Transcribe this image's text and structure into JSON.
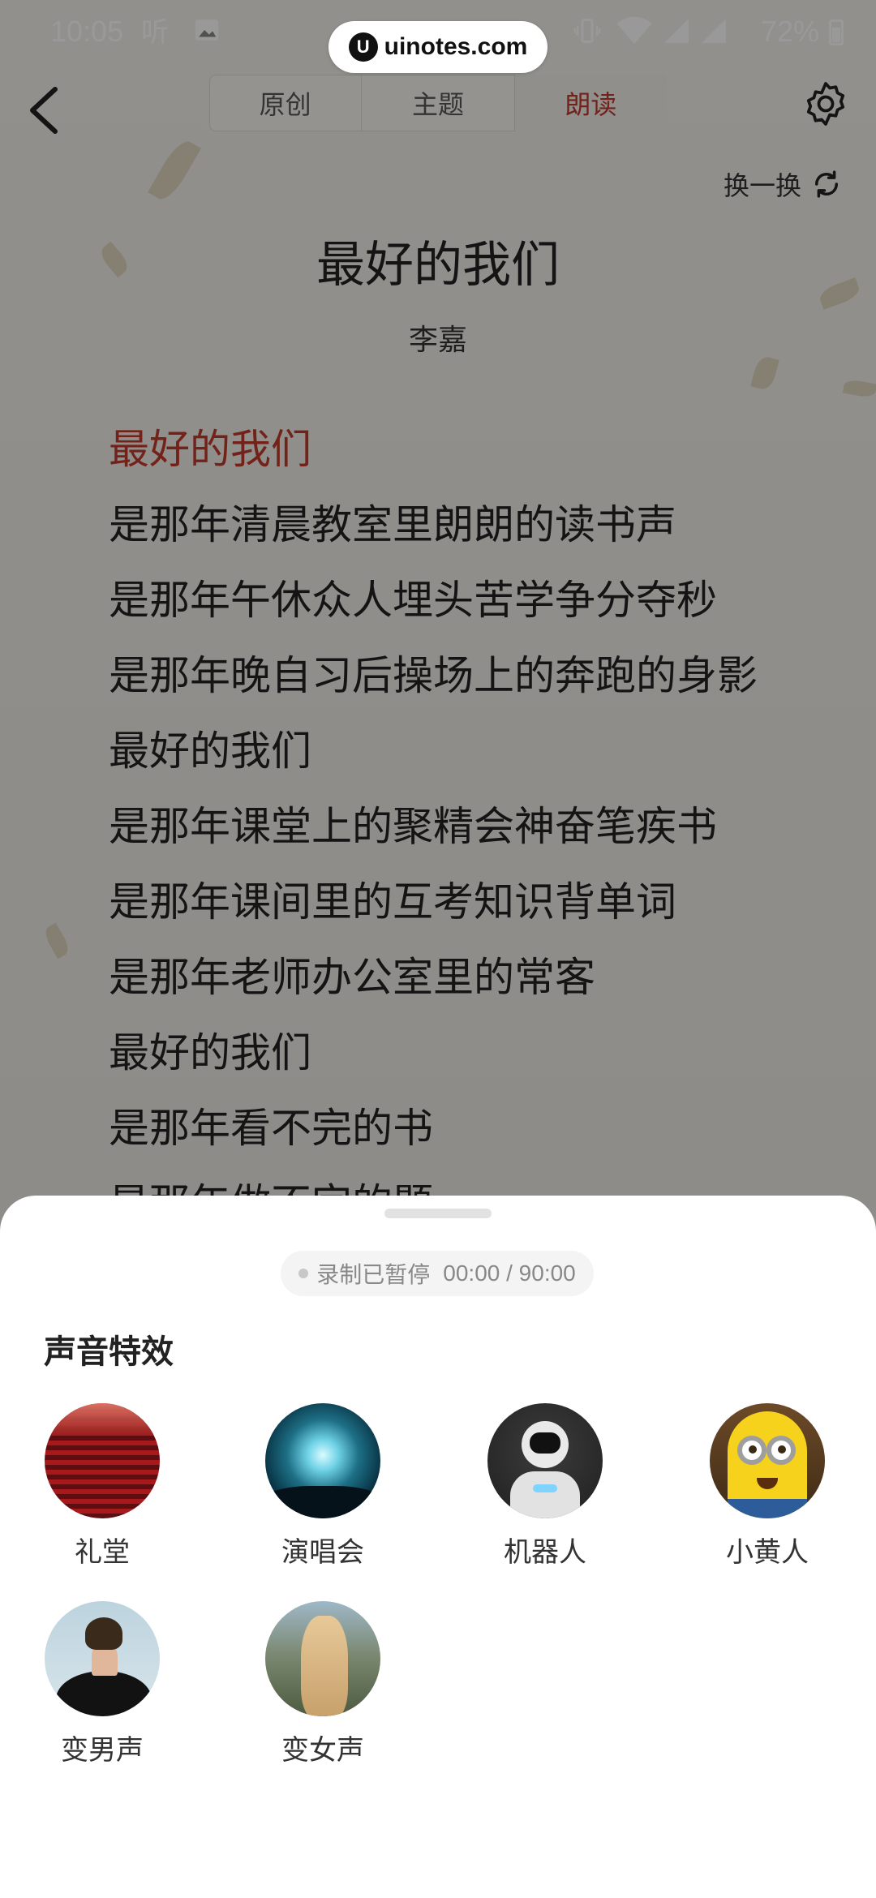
{
  "status_bar": {
    "time": "10:05",
    "notif_icon_1": "听",
    "battery": "72%"
  },
  "watermark": {
    "logo": "U",
    "text": "uinotes.com"
  },
  "tabs": [
    {
      "label": "原创",
      "active": false
    },
    {
      "label": "主题",
      "active": false
    },
    {
      "label": "朗读",
      "active": true
    }
  ],
  "header": {
    "swap_label": "换一换"
  },
  "poem": {
    "title": "最好的我们",
    "author": "李嘉",
    "lines": [
      "最好的我们",
      "是那年清晨教室里朗朗的读书声",
      "是那年午休众人埋头苦学争分夺秒",
      "是那年晚自习后操场上的奔跑的身影",
      "最好的我们",
      "是那年课堂上的聚精会神奋笔疾书",
      "是那年课间里的互考知识背单词",
      "是那年老师办公室里的常客",
      "最好的我们",
      "是那年看不完的书",
      "是那年做不完的题"
    ],
    "highlight_index": 0
  },
  "sheet": {
    "record_status": "录制已暂停",
    "record_time": "00:00 / 90:00",
    "section_title": "声音特效",
    "effects": [
      {
        "label": "礼堂",
        "icon": "auditorium-image"
      },
      {
        "label": "演唱会",
        "icon": "concert-image"
      },
      {
        "label": "机器人",
        "icon": "robot-image"
      },
      {
        "label": "小黄人",
        "icon": "minion-image"
      },
      {
        "label": "变男声",
        "icon": "male-voice-image"
      },
      {
        "label": "变女声",
        "icon": "female-voice-image"
      }
    ]
  },
  "colors": {
    "accent": "#c0392b",
    "overlay": "rgba(0,0,0,0.40)"
  }
}
